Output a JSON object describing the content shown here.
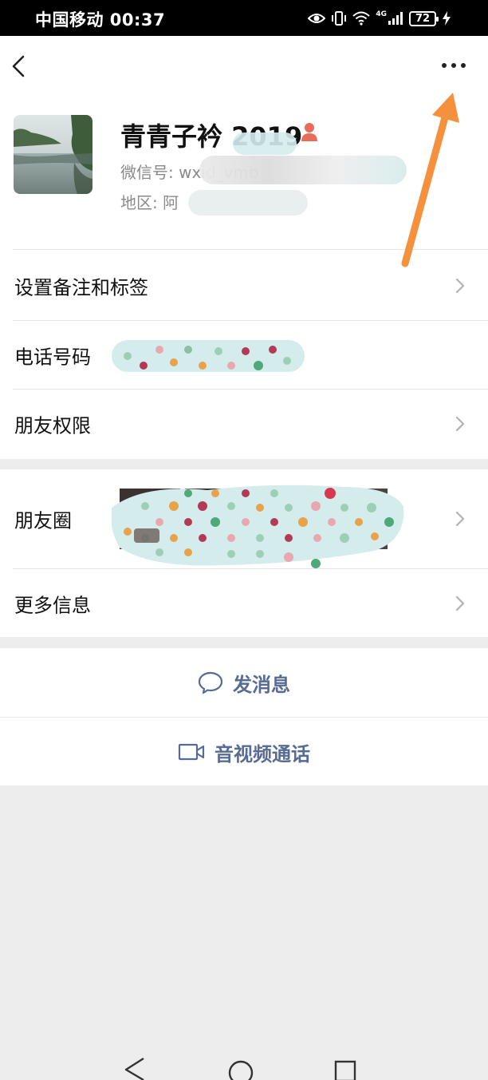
{
  "status_bar": {
    "carrier_time": "中国移动 00:37",
    "battery": "72",
    "network": "4G"
  },
  "profile": {
    "name": "青青子衿 2019",
    "wechat_id": "微信号: wxid_vmb",
    "region": "地区: 阿"
  },
  "rows": {
    "remark": "设置备注和标签",
    "phone": "电话号码",
    "permissions": "朋友权限",
    "moments": "朋友圈",
    "more_info": "更多信息"
  },
  "actions": {
    "message": "发消息",
    "video_call": "音视频通话"
  },
  "icons": {
    "back": "chevron-left-icon",
    "more": "more-dots-icon",
    "gender": "female-icon",
    "chevron": "chevron-right-icon",
    "chat": "chat-bubble-icon",
    "video": "video-camera-icon"
  },
  "colors": {
    "link_blue": "#576b95",
    "annotation_orange": "#f5913c",
    "gender_icon": "#e96b5a"
  }
}
